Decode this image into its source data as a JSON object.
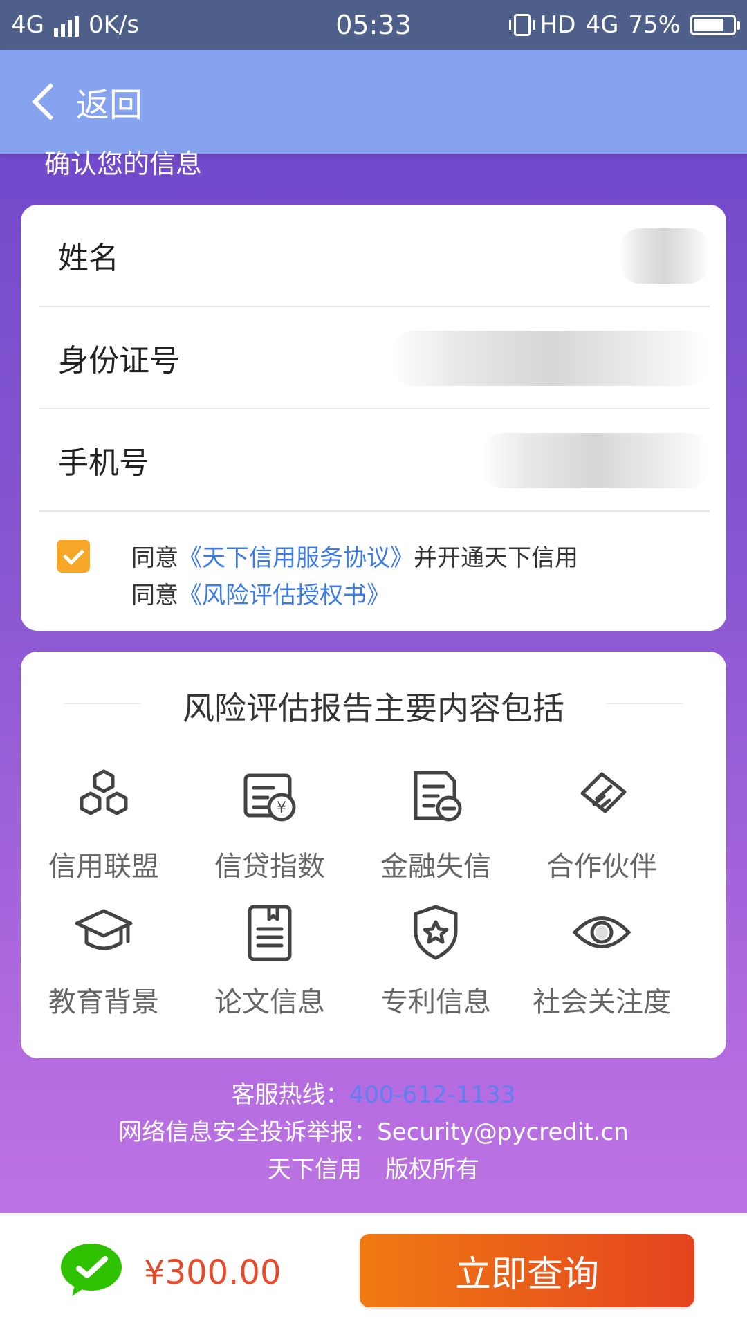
{
  "status_bar": {
    "network": "4G",
    "speed": "0K/s",
    "time": "05:33",
    "hd": "HD",
    "network_right": "4G",
    "battery": "75%",
    "battery_level": 0.75
  },
  "header": {
    "back_label": "返回"
  },
  "section_title": "确认您的信息",
  "form": {
    "fields": [
      {
        "label": "姓名"
      },
      {
        "label": "身份证号"
      },
      {
        "label": "手机号"
      }
    ],
    "agree_checked": true,
    "agree": {
      "line1_prefix": "同意",
      "line1_link": "《天下信用服务协议》",
      "line1_suffix": "并开通天下信用",
      "line2_prefix": "同意",
      "line2_link": "《风险评估授权书》"
    }
  },
  "report": {
    "title": "风险评估报告主要内容包括",
    "items": [
      {
        "label": "信用联盟",
        "icon": "hexagons-icon"
      },
      {
        "label": "信贷指数",
        "icon": "credit-doc-icon"
      },
      {
        "label": "金融失信",
        "icon": "doc-minus-icon"
      },
      {
        "label": "合作伙伴",
        "icon": "handshake-icon"
      },
      {
        "label": "教育背景",
        "icon": "graduation-cap-icon"
      },
      {
        "label": "论文信息",
        "icon": "paper-list-icon"
      },
      {
        "label": "专利信息",
        "icon": "shield-star-icon"
      },
      {
        "label": "社会关注度",
        "icon": "eye-icon"
      }
    ]
  },
  "footer": {
    "hotline_label": "客服热线：",
    "hotline_number": "400-612-1133",
    "security_text": "网络信息安全投诉举报：Security@pycredit.cn",
    "copyright": "天下信用　版权所有"
  },
  "bottom_bar": {
    "price": "¥300.00",
    "query_button": "立即查询"
  },
  "colors": {
    "accent_orange": "#f7a728",
    "link_blue": "#3c7be7",
    "price_red": "#e54a2a"
  }
}
